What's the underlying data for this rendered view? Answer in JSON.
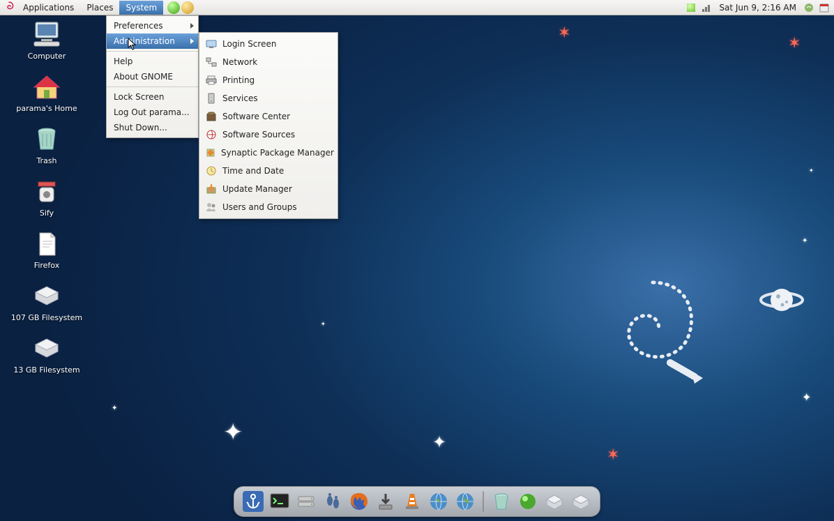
{
  "panel": {
    "menus": [
      "Applications",
      "Places",
      "System"
    ],
    "open_menu_index": 2,
    "clock": "Sat Jun  9,  2:16 AM"
  },
  "system_menu": {
    "items": [
      {
        "label": "Preferences",
        "arrow": true,
        "selected": false
      },
      {
        "label": "Administration",
        "arrow": true,
        "selected": true
      }
    ],
    "help_label": "Help",
    "about_label": "About GNOME",
    "lock_label": "Lock Screen",
    "logout_label": "Log Out parama...",
    "shutdown_label": "Shut Down..."
  },
  "admin_menu": {
    "items": [
      {
        "label": "Login Screen",
        "icon": "login-screen-icon"
      },
      {
        "label": "Network",
        "icon": "network-icon"
      },
      {
        "label": "Printing",
        "icon": "printer-icon"
      },
      {
        "label": "Services",
        "icon": "services-icon"
      },
      {
        "label": "Software Center",
        "icon": "software-center-icon"
      },
      {
        "label": "Software Sources",
        "icon": "software-sources-icon"
      },
      {
        "label": "Synaptic Package Manager",
        "icon": "synaptic-icon"
      },
      {
        "label": "Time and Date",
        "icon": "clock-icon"
      },
      {
        "label": "Update Manager",
        "icon": "update-manager-icon"
      },
      {
        "label": "Users and Groups",
        "icon": "users-icon"
      }
    ]
  },
  "desktop": {
    "icons": [
      {
        "label": "Computer",
        "icon": "computer-icon"
      },
      {
        "label": "parama's Home",
        "icon": "home-folder-icon"
      },
      {
        "label": "Trash",
        "icon": "trash-icon"
      },
      {
        "label": "Sify",
        "icon": "sify-launcher-icon"
      },
      {
        "label": "Firefox",
        "icon": "document-icon"
      },
      {
        "label": "107 GB Filesystem",
        "icon": "drive-icon"
      },
      {
        "label": "13 GB Filesystem",
        "icon": "drive-icon"
      }
    ]
  },
  "dock": {
    "items": [
      {
        "name": "anchor",
        "icon": "anchor-icon"
      },
      {
        "name": "terminal",
        "icon": "terminal-icon"
      },
      {
        "name": "drive",
        "icon": "drive-stack-icon"
      },
      {
        "name": "footprints",
        "icon": "gnome-foot-icon"
      },
      {
        "name": "firefox",
        "icon": "firefox-icon"
      },
      {
        "name": "downloads",
        "icon": "download-icon"
      },
      {
        "name": "vlc",
        "icon": "vlc-icon"
      },
      {
        "name": "globe1",
        "icon": "globe-icon"
      },
      {
        "name": "globe2",
        "icon": "globe-icon"
      },
      {
        "name": "trash",
        "icon": "trash-dock-icon"
      },
      {
        "name": "status",
        "icon": "green-dot-icon"
      },
      {
        "name": "volume1",
        "icon": "volume-icon"
      },
      {
        "name": "volume2",
        "icon": "volume-icon"
      }
    ]
  }
}
